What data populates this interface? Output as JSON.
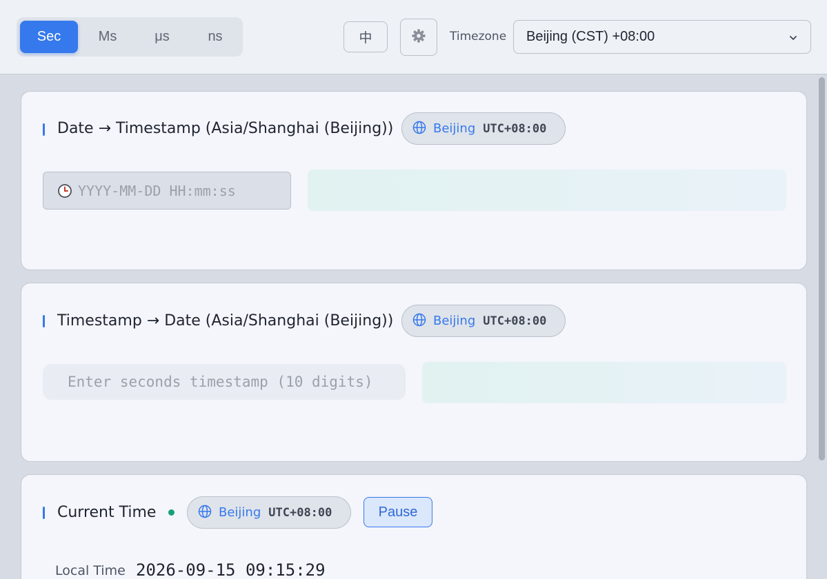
{
  "units": {
    "items": [
      {
        "label": "Sec",
        "active": true
      },
      {
        "label": "Ms",
        "active": false
      },
      {
        "label": "μs",
        "active": false
      },
      {
        "label": "ns",
        "active": false
      }
    ]
  },
  "toolbar": {
    "language_label": "中",
    "settings_icon": "gear-icon",
    "timezone_label": "Timezone",
    "timezone_value": "Beijing (CST) +08:00"
  },
  "tz_chip": {
    "city": "Beijing",
    "offset": "UTC+08:00",
    "icon": "globe-icon"
  },
  "date_to_ts": {
    "title": "Date → Timestamp (Asia/Shanghai (Beijing))",
    "placeholder": "YYYY-MM-DD HH:mm:ss",
    "icon": "clock-icon"
  },
  "ts_to_date": {
    "title": "Timestamp → Date (Asia/Shanghai (Beijing))",
    "placeholder": "Enter seconds timestamp (10 digits)"
  },
  "current_time": {
    "title": "Current Time",
    "pause_label": "Pause",
    "local_label": "Local Time",
    "local_value": "2026-09-15 09:15:29"
  },
  "colors": {
    "accent": "#3579ec",
    "live": "#16a07c"
  }
}
